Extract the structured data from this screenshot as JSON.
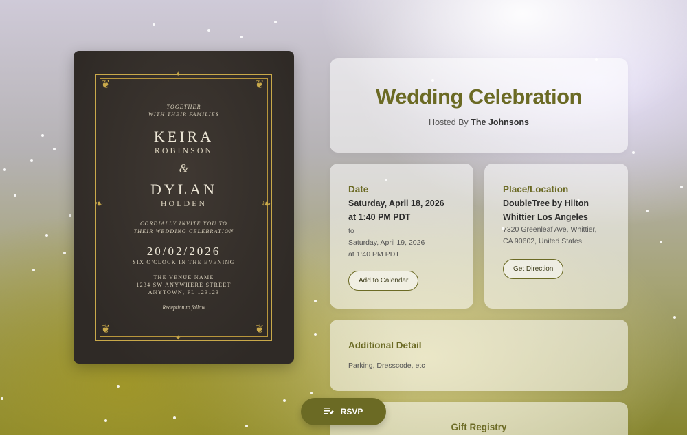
{
  "invitation": {
    "together": "TOGETHER",
    "with_families": "WITH THEIR FAMILIES",
    "name1": "KEIRA",
    "surname1": "ROBINSON",
    "amp": "&",
    "name2": "DYLAN",
    "surname2": "HOLDEN",
    "invite_line1": "CORDIALLY INVITE YOU TO",
    "invite_line2": "THEIR WEDDING CELEBRATION",
    "date": "20/02/2026",
    "time": "SIX O'CLOCK IN THE EVENING",
    "venue1": "THE VENUE NAME",
    "venue2": "1234 SW ANYWHERE STREET",
    "venue3": "ANYTOWN, FL 123123",
    "reception": "Reception to follow"
  },
  "event": {
    "title": "Wedding Celebration",
    "hosted_prefix": "Hosted By",
    "host": "The Johnsons"
  },
  "date_card": {
    "label": "Date",
    "start_date": "Saturday, April 18, 2026",
    "start_time": "at 1:40 PM PDT",
    "to": "to",
    "end_date": "Saturday, April 19, 2026",
    "end_time": "at 1:40 PM PDT",
    "button": "Add to Calendar"
  },
  "location_card": {
    "label": "Place/Location",
    "venue_line1": "DoubleTree by Hilton",
    "venue_line2": "Whittier Los Angeles",
    "address_line1": "7320 Greenleaf Ave, Whittier,",
    "address_line2": "CA 90602, United States",
    "button": "Get Direction"
  },
  "additional": {
    "label": "Additional Detail",
    "text": "Parking, Dresscode, etc"
  },
  "gift": {
    "label": "Gift Registry"
  },
  "rsvp": {
    "icon": "list-edit-icon",
    "label": "RSVP"
  },
  "colors": {
    "accent": "#6b6a24",
    "invite_bg": "#2f2a26",
    "gold": "#c9a94a"
  }
}
